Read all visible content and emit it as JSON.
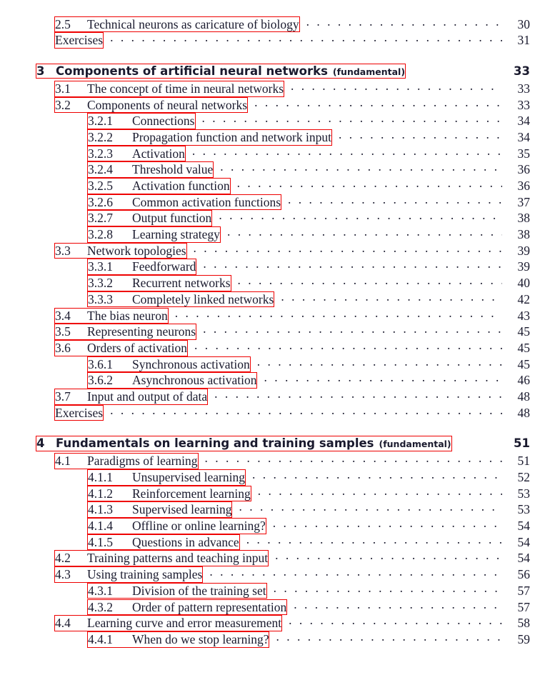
{
  "document": {
    "type": "table-of-contents",
    "link_box_color": "#ee0000",
    "text_color": "#1a1a2e"
  },
  "entries": [
    {
      "level": "section",
      "number": "2.5",
      "title": "Technical neurons as caricature of biology",
      "page": "30"
    },
    {
      "level": "section",
      "number": "",
      "title": "Exercises",
      "page": "31",
      "exercises": true
    },
    {
      "level": "chapter",
      "number": "3",
      "title": "Components of artificial neural networks",
      "tag": "(fundamental)",
      "page": "33"
    },
    {
      "level": "section",
      "number": "3.1",
      "title": "The concept of time in neural networks",
      "page": "33"
    },
    {
      "level": "section",
      "number": "3.2",
      "title": "Components of neural networks",
      "page": "33"
    },
    {
      "level": "subsec",
      "number": "3.2.1",
      "title": "Connections",
      "page": "34"
    },
    {
      "level": "subsec",
      "number": "3.2.2",
      "title": "Propagation function and network input",
      "page": "34"
    },
    {
      "level": "subsec",
      "number": "3.2.3",
      "title": "Activation",
      "page": "35"
    },
    {
      "level": "subsec",
      "number": "3.2.4",
      "title": "Threshold value",
      "page": "36"
    },
    {
      "level": "subsec",
      "number": "3.2.5",
      "title": "Activation function",
      "page": "36"
    },
    {
      "level": "subsec",
      "number": "3.2.6",
      "title": "Common activation functions",
      "page": "37"
    },
    {
      "level": "subsec",
      "number": "3.2.7",
      "title": "Output function",
      "page": "38"
    },
    {
      "level": "subsec",
      "number": "3.2.8",
      "title": "Learning strategy",
      "page": "38"
    },
    {
      "level": "section",
      "number": "3.3",
      "title": "Network topologies",
      "page": "39"
    },
    {
      "level": "subsec",
      "number": "3.3.1",
      "title": "Feedforward",
      "page": "39"
    },
    {
      "level": "subsec",
      "number": "3.3.2",
      "title": "Recurrent networks",
      "page": "40"
    },
    {
      "level": "subsec",
      "number": "3.3.3",
      "title": "Completely linked networks",
      "page": "42"
    },
    {
      "level": "section",
      "number": "3.4",
      "title": "The bias neuron",
      "page": "43"
    },
    {
      "level": "section",
      "number": "3.5",
      "title": "Representing neurons",
      "page": "45"
    },
    {
      "level": "section",
      "number": "3.6",
      "title": "Orders of activation",
      "page": "45"
    },
    {
      "level": "subsec",
      "number": "3.6.1",
      "title": "Synchronous activation",
      "page": "45"
    },
    {
      "level": "subsec",
      "number": "3.6.2",
      "title": "Asynchronous activation",
      "page": "46"
    },
    {
      "level": "section",
      "number": "3.7",
      "title": "Input and output of data",
      "page": "48"
    },
    {
      "level": "section",
      "number": "",
      "title": "Exercises",
      "page": "48",
      "exercises": true
    },
    {
      "level": "chapter",
      "number": "4",
      "title": "Fundamentals on learning and training samples",
      "tag": "(fundamental)",
      "page": "51"
    },
    {
      "level": "section",
      "number": "4.1",
      "title": "Paradigms of learning",
      "page": "51"
    },
    {
      "level": "subsec",
      "number": "4.1.1",
      "title": "Unsupervised learning",
      "page": "52"
    },
    {
      "level": "subsec",
      "number": "4.1.2",
      "title": "Reinforcement learning",
      "page": "53"
    },
    {
      "level": "subsec",
      "number": "4.1.3",
      "title": "Supervised learning",
      "page": "53"
    },
    {
      "level": "subsec",
      "number": "4.1.4",
      "title": "Offline or online learning?",
      "page": "54"
    },
    {
      "level": "subsec",
      "number": "4.1.5",
      "title": "Questions in advance",
      "page": "54"
    },
    {
      "level": "section",
      "number": "4.2",
      "title": "Training patterns and teaching input",
      "page": "54"
    },
    {
      "level": "section",
      "number": "4.3",
      "title": "Using training samples",
      "page": "56"
    },
    {
      "level": "subsec",
      "number": "4.3.1",
      "title": "Division of the training set",
      "page": "57"
    },
    {
      "level": "subsec",
      "number": "4.3.2",
      "title": "Order of pattern representation",
      "page": "57"
    },
    {
      "level": "section",
      "number": "4.4",
      "title": "Learning curve and error measurement",
      "page": "58"
    },
    {
      "level": "subsec",
      "number": "4.4.1",
      "title": "When do we stop learning?",
      "page": "59"
    }
  ]
}
